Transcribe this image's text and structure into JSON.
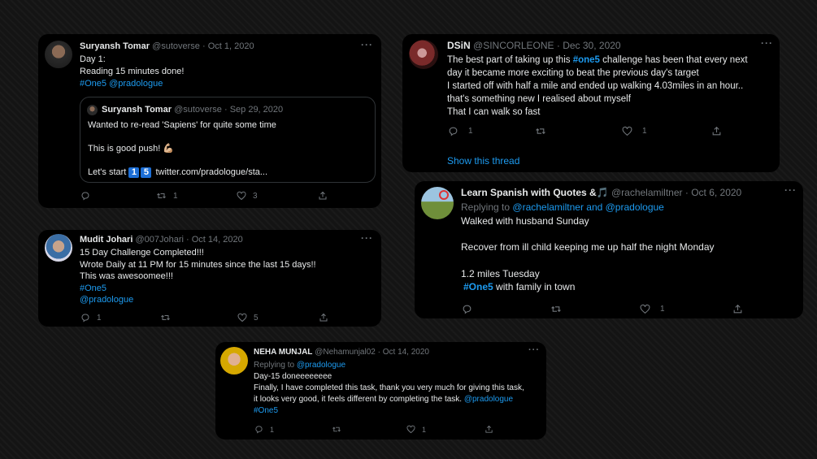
{
  "tweets": {
    "t1": {
      "name": "Suryansh Tomar",
      "handle": "@sutoverse · Oct 1, 2020",
      "line1": "Day 1:",
      "line2": "Reading 15 minutes done!",
      "hashtag": "#One5",
      "mention": "@pradologue",
      "quote": {
        "name": "Suryansh Tomar",
        "handle": "@sutoverse · Sep 29, 2020",
        "line1": "Wanted to re-read 'Sapiens' for quite some time",
        "line2": "This is good push! 💪🏼",
        "line3_prefix": "Let's start",
        "badge1": "1",
        "badge2": "5",
        "link": "twitter.com/pradologue/sta..."
      },
      "retweets": "1",
      "likes": "3"
    },
    "t2": {
      "name": "Mudit Johari",
      "handle": "@007Johari · Oct 14, 2020",
      "line1": "15 Day Challenge Completed!!!",
      "line2": "Wrote Daily at 11 PM for 15 minutes since the last 15 days!!",
      "line3": "This was awesoomee!!!",
      "hashtag": "#One5",
      "mention": "@pradologue",
      "replies": "1",
      "likes": "5"
    },
    "t3": {
      "name": "NEHA MUNJAL",
      "handle": "@Nehamunjal02 · Oct 14, 2020",
      "replying_prefix": "Replying to",
      "replying_to": "@pradologue",
      "line1": "Day-15 doneeeeeeee",
      "line2": "Finally, I have completed this task, thank you very much for giving this task,",
      "line3": "it looks very good, it feels different by completing the task.",
      "line3_mention": "@pradologue",
      "hashtag": "#One5",
      "replies": "1",
      "likes": "1"
    },
    "t4": {
      "name": "DSiN",
      "handle": "@SINCORLEONE · Dec 30, 2020",
      "line1_a": "The best part of taking up this",
      "line1_tag": "#one5",
      "line1_b": "challenge has been that every next",
      "line2": "day it became more exciting to beat the previous day's target",
      "line3": "I started off with half a mile and ended up walking 4.03miles in an hour..",
      "line4": "that's something new I realised about myself",
      "line5": "That I can walk so fast",
      "replies": "1",
      "likes": "1",
      "show_thread": "Show this thread"
    },
    "t5": {
      "name": "Learn Spanish with Quotes &🎵",
      "handle": "@rachelamiltner · Oct 6, 2020",
      "replying_prefix": "Replying to",
      "replying_to": "@rachelamiltner and @pradologue",
      "line1": "Walked with husband Sunday",
      "line2": "Recover from ill child keeping me up half the night Monday",
      "line3": "1.2 miles Tuesday",
      "hashtag": "#One5",
      "line4_rest": "with family in town",
      "likes": "1"
    }
  },
  "more_label": "···",
  "colors": {
    "accent": "#1d9bf0",
    "muted": "#71767b",
    "card": "#000000"
  }
}
